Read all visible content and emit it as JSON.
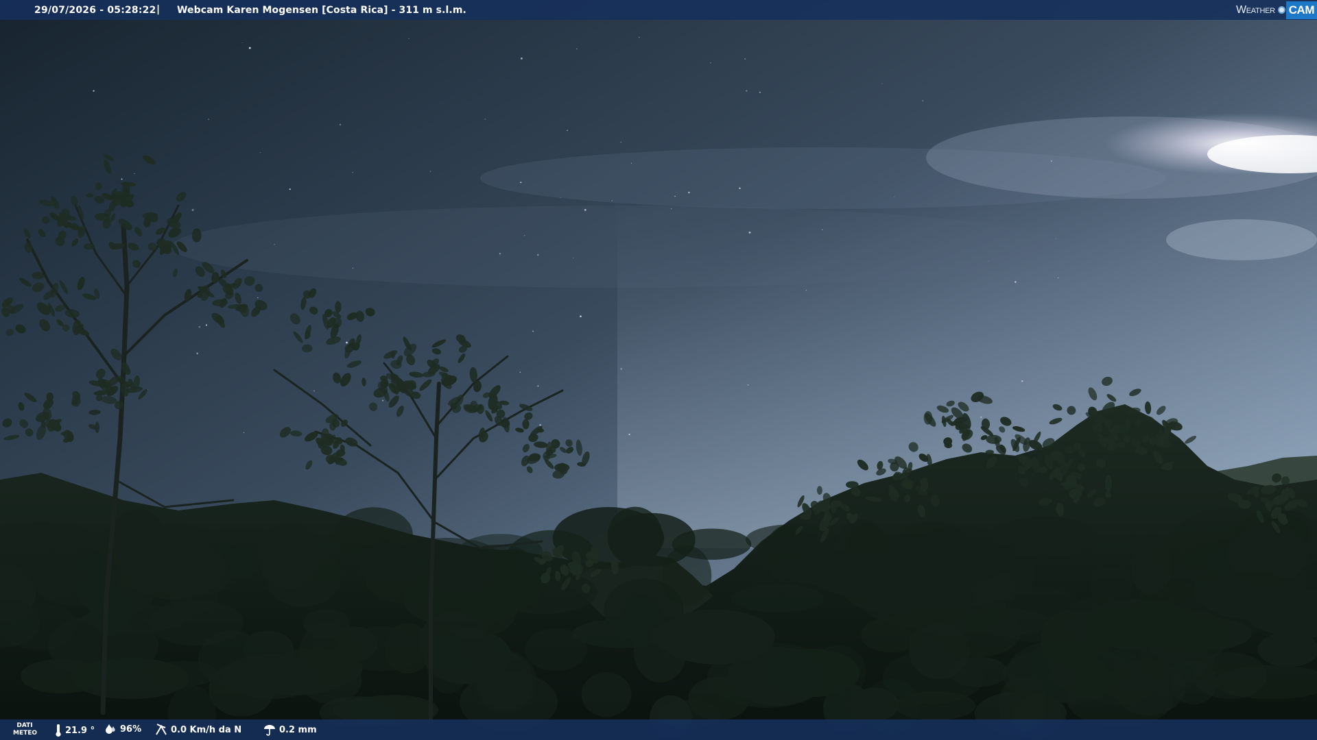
{
  "header": {
    "timestamp": "29/07/2026 - 05:28:22",
    "separator": "|",
    "title": "Webcam Karen Mogensen [Costa Rica]  - 311 m s.l.m."
  },
  "logo": {
    "weather": "Weather",
    "cam": "CAM"
  },
  "footer": {
    "dati_line1": "DATI",
    "dati_line2": "METEO",
    "temperature": "21.9 °",
    "humidity": "96%",
    "wind": "0.0 Km/h da N",
    "rain": "0.2 mm"
  },
  "icons": {
    "temperature": "thermometer-icon",
    "humidity": "humidity-icon",
    "wind": "wind-icon",
    "rain": "rain-icon"
  },
  "colors": {
    "bar": "#16305c",
    "logo_accent": "#1e78c8"
  }
}
